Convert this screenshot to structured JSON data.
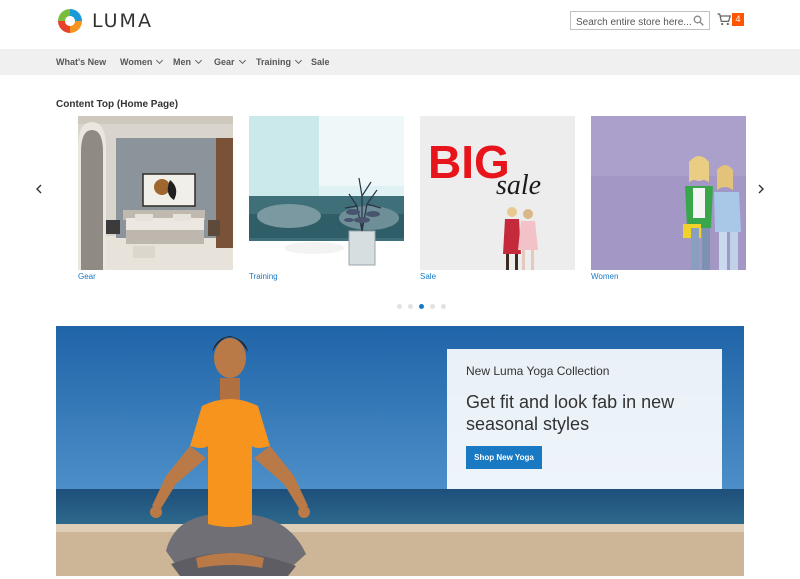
{
  "brand": {
    "name": "LUMA"
  },
  "search": {
    "placeholder": "Search entire store here..."
  },
  "cart": {
    "count": "4"
  },
  "nav": {
    "items": [
      {
        "label": "What's New",
        "has_menu": false
      },
      {
        "label": "Women",
        "has_menu": true
      },
      {
        "label": "Men",
        "has_menu": true
      },
      {
        "label": "Gear",
        "has_menu": true
      },
      {
        "label": "Training",
        "has_menu": true
      },
      {
        "label": "Sale",
        "has_menu": false
      }
    ]
  },
  "carousel": {
    "title": "Content Top (Home Page)",
    "slides": [
      {
        "caption": "Gear"
      },
      {
        "caption": "Training"
      },
      {
        "caption": "Sale",
        "image_text": {
          "big": "BIG",
          "sale": "sale"
        }
      },
      {
        "caption": "Women"
      }
    ],
    "dot_count": 5,
    "active_dot": 2,
    "icons": {
      "prev": "chevron-left-icon",
      "next": "chevron-right-icon"
    }
  },
  "hero": {
    "kicker": "New Luma Yoga Collection",
    "headline": "Get fit and look fab in new seasonal styles",
    "button_label": "Shop New Yoga"
  },
  "colors": {
    "accent": "#1979c3",
    "cart_badge": "#ff5501",
    "nav_bg": "#f0f0f0",
    "sale_red": "#e8141b"
  }
}
